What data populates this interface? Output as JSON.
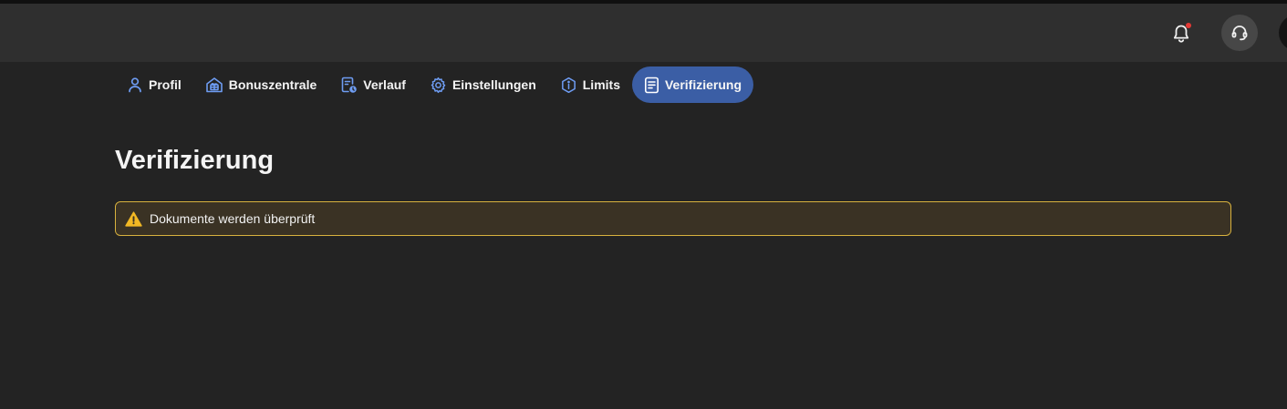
{
  "header": {
    "notifications": {
      "icon": "bell-icon",
      "has_unread": true
    },
    "support": {
      "icon": "headset-icon"
    }
  },
  "tabs": [
    {
      "label": "Profil",
      "icon": "user-icon",
      "active": false
    },
    {
      "label": "Bonuszentrale",
      "icon": "gift-box-icon",
      "active": false
    },
    {
      "label": "Verlauf",
      "icon": "history-icon",
      "active": false
    },
    {
      "label": "Einstellungen",
      "icon": "gear-icon",
      "active": false
    },
    {
      "label": "Limits",
      "icon": "info-hexagon-icon",
      "active": false
    },
    {
      "label": "Verifizierung",
      "icon": "document-icon",
      "active": true
    }
  ],
  "page": {
    "title": "Verifizierung"
  },
  "status_alert": {
    "icon": "warning-icon",
    "text": "Dokumente werden überprüft"
  },
  "colors": {
    "background": "#232323",
    "header": "#2f2f2f",
    "accent": "#3b5ea5",
    "icon_blue": "#6e9cf2",
    "warning_border": "#d8b23e",
    "warning_bg": "#3a3224",
    "notification_dot": "#e53935"
  }
}
